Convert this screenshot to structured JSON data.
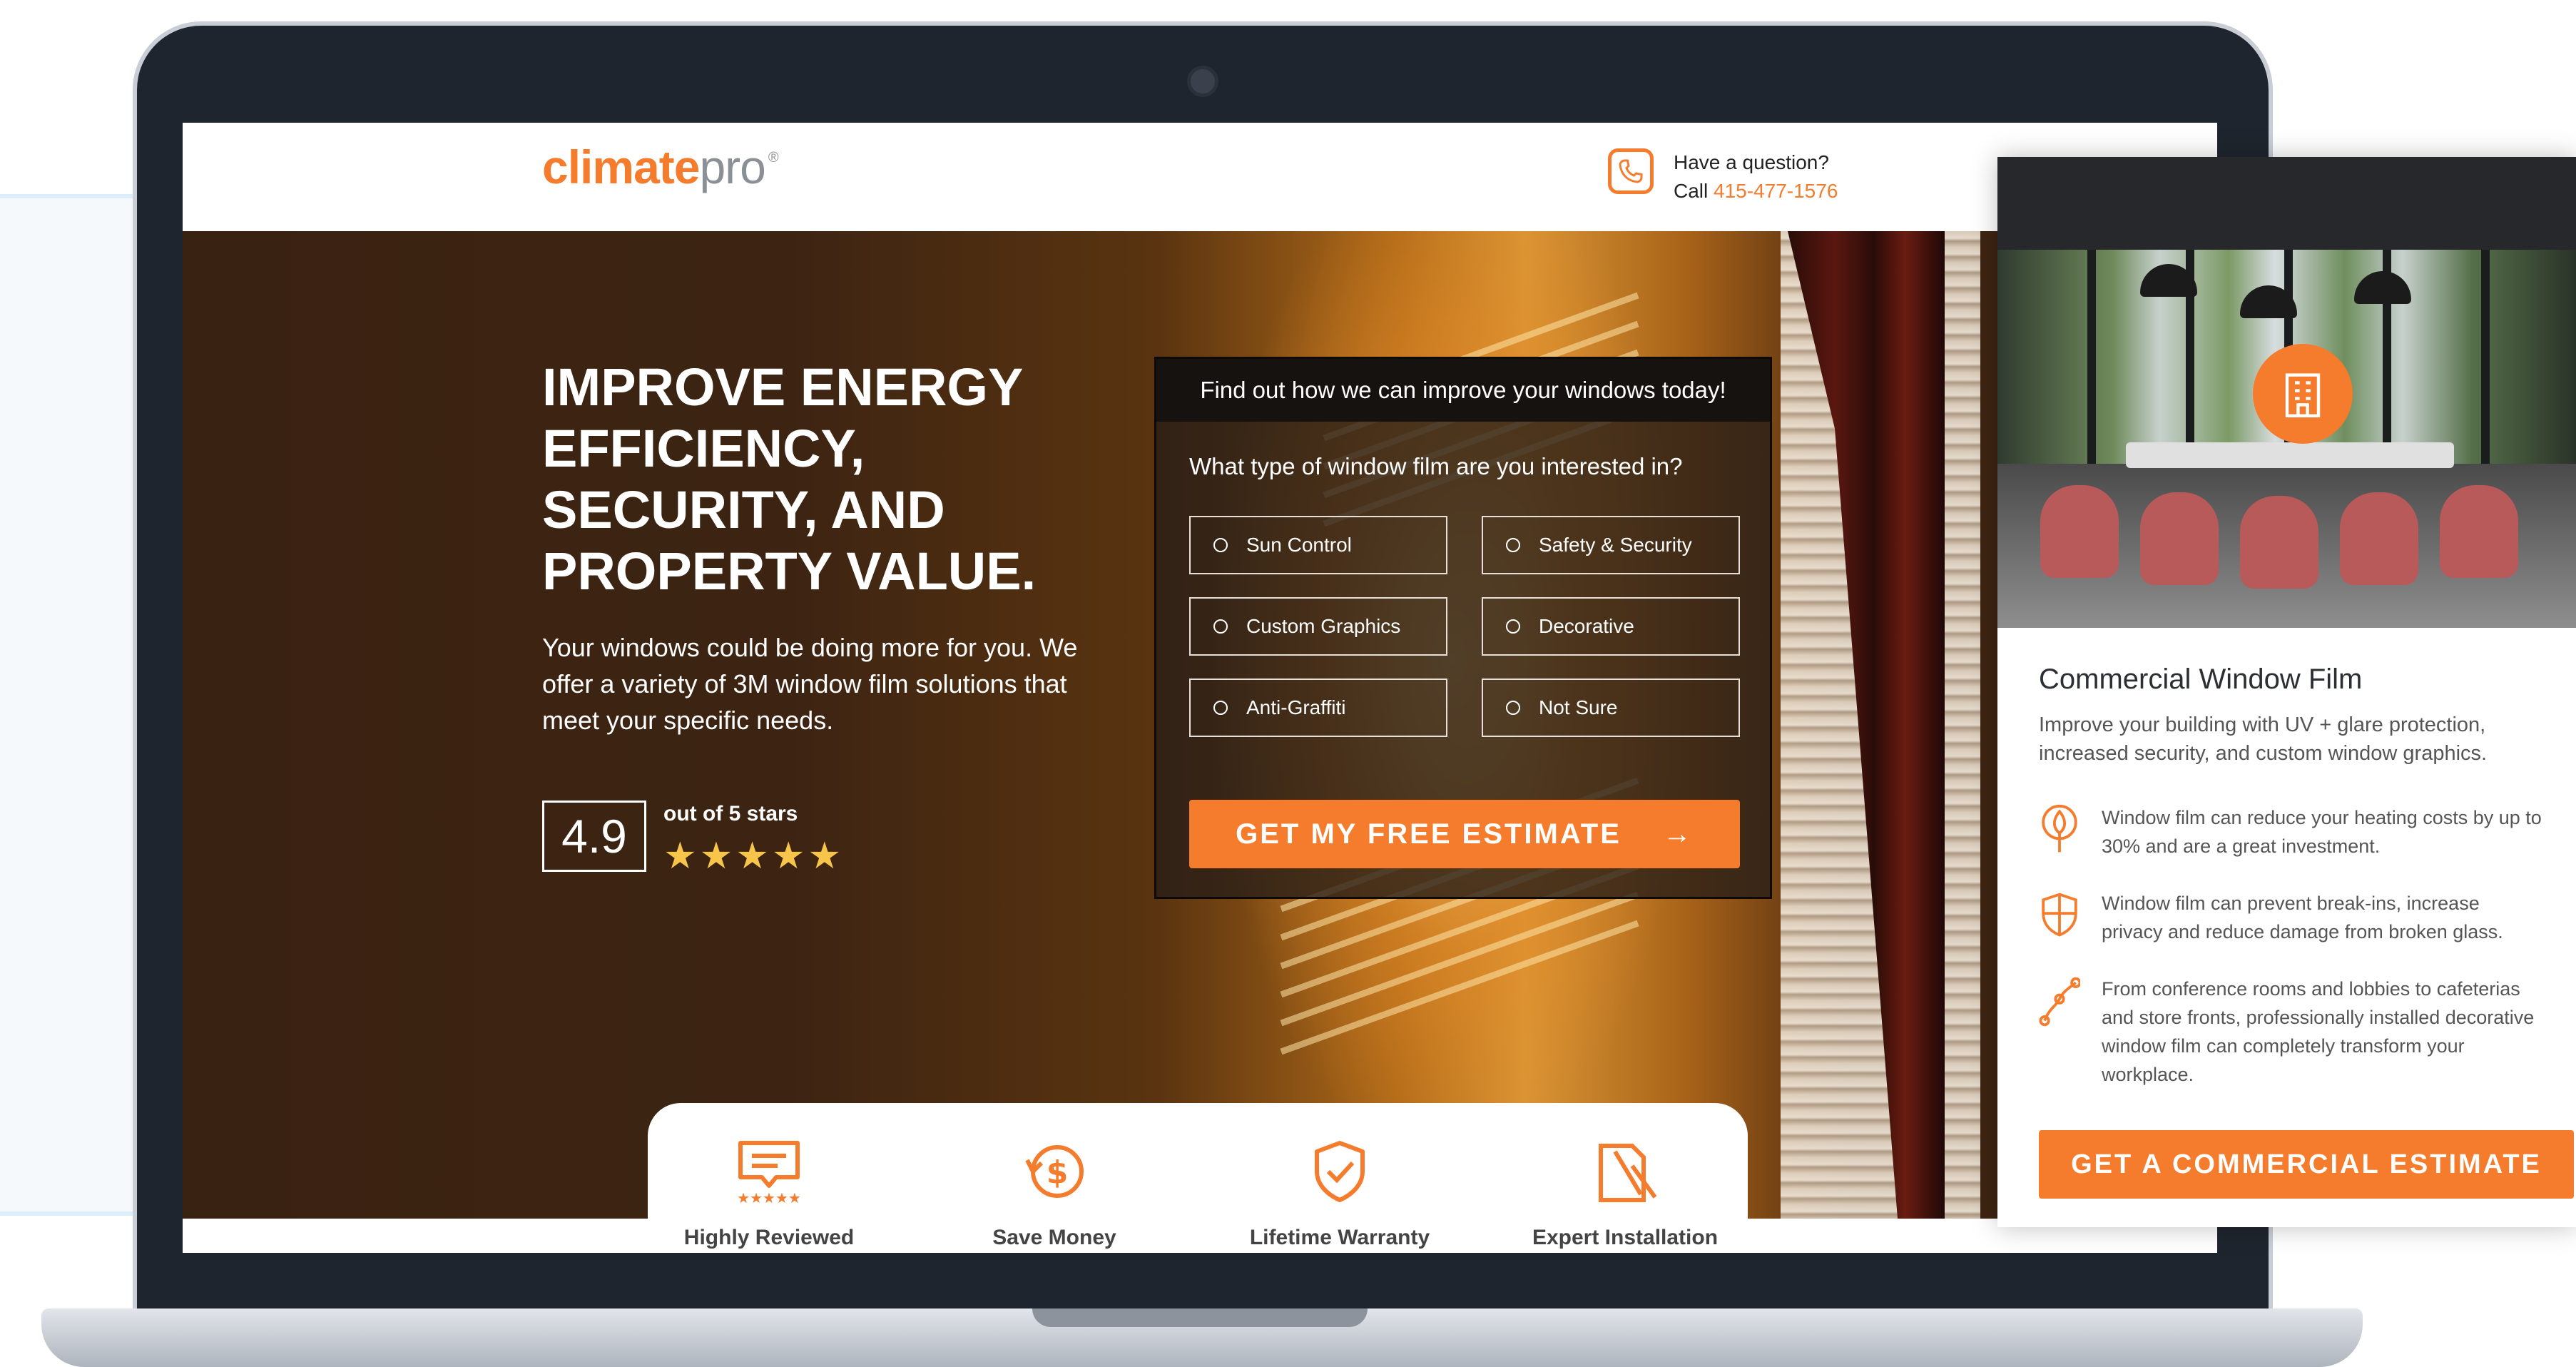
{
  "brand": {
    "name_part1": "climate",
    "name_part2": "pro",
    "mark": "®"
  },
  "header": {
    "question": "Have a question?",
    "call_label": "Call",
    "phone": "415-477-1576"
  },
  "hero": {
    "title": "IMPROVE ENERGY EFFICIENCY, SECURITY, AND PROPERTY VALUE.",
    "subtitle": "Your windows could be doing more for you. We offer a variety of 3M window film solutions that meet your specific needs.",
    "rating_value": "4.9",
    "rating_label": "out of 5 stars",
    "stars": "★★★★★",
    "rating_stars": 5
  },
  "form": {
    "header": "Find out how we can improve your windows today!",
    "question": "What type of window film are you interested in?",
    "options": [
      "Sun Control",
      "Safety & Security",
      "Custom Graphics",
      "Decorative",
      "Anti-Graffiti",
      "Not Sure"
    ],
    "cta_label": "GET MY FREE ESTIMATE",
    "cta_arrow": "→"
  },
  "features": [
    {
      "label": "Highly Reviewed",
      "icon": "review-icon"
    },
    {
      "label": "Save Money",
      "icon": "save-money-icon"
    },
    {
      "label": "Lifetime Warranty",
      "icon": "shield-check-icon"
    },
    {
      "label": "Expert Installation",
      "icon": "tools-icon"
    }
  ],
  "card": {
    "title": "Commercial Window Film",
    "subtitle": "Improve your building with UV + glare protection, increased security, and custom window graphics.",
    "bullets": [
      {
        "icon": "leaf-icon",
        "text": "Window film can reduce your heating costs by up to 30% and are a great investment."
      },
      {
        "icon": "shield-icon",
        "text": "Window film can prevent break-ins, increase privacy and reduce damage from broken glass."
      },
      {
        "icon": "decorative-path-icon",
        "text": "From conference rooms and lobbies to cafeterias and store fronts, professionally installed decorative window film can completely transform your workplace."
      }
    ],
    "cta_label": "GET A COMMERCIAL ESTIMATE"
  },
  "colors": {
    "accent": "#f47c2c",
    "star": "#f6c54a",
    "hero_dark": "#3a2212"
  }
}
